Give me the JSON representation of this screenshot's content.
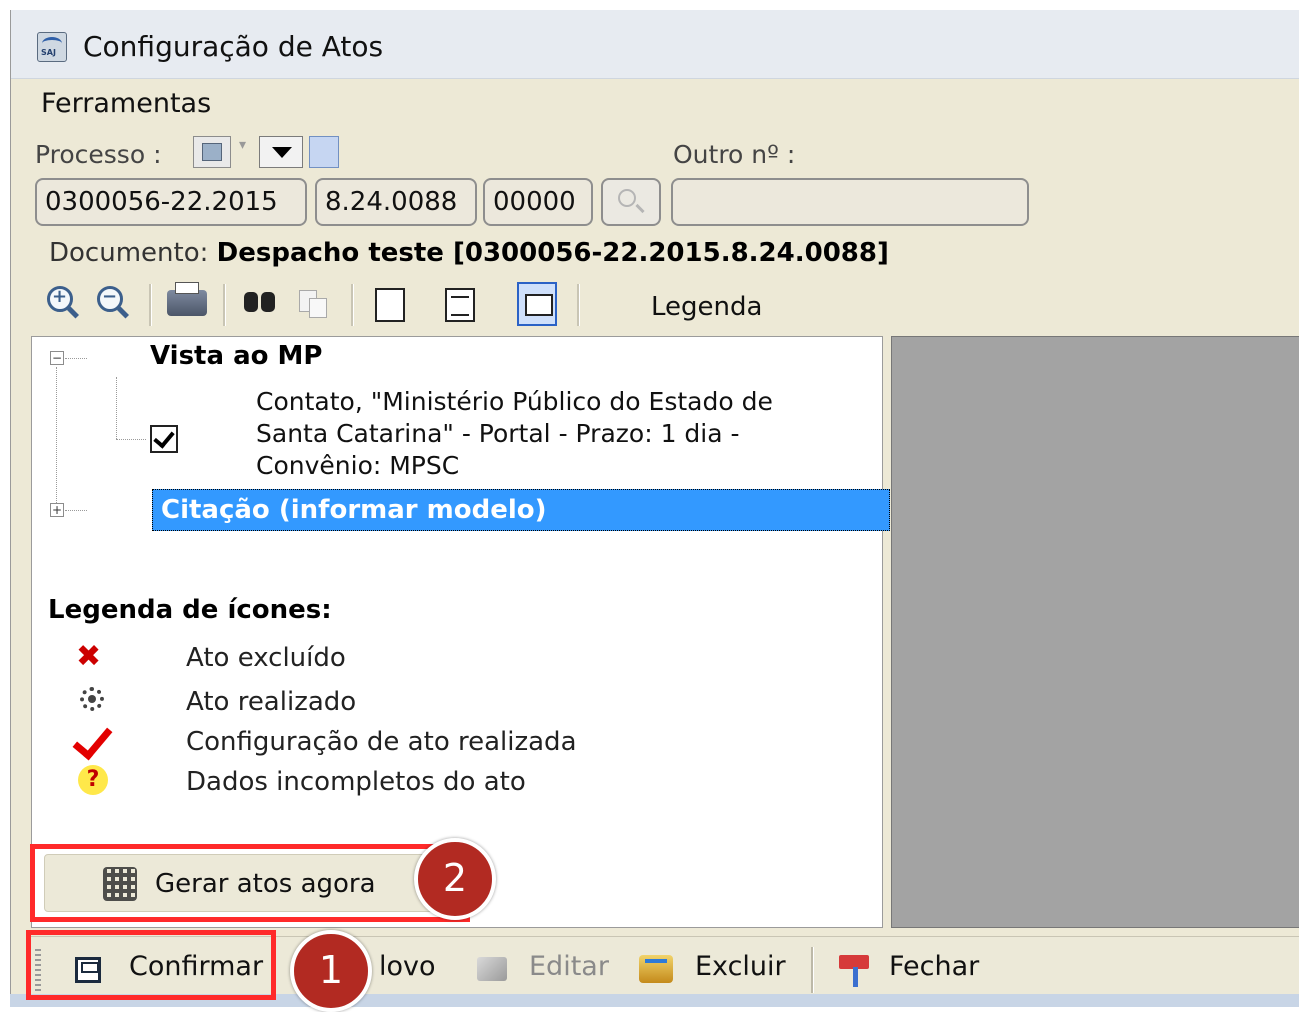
{
  "window": {
    "title": "Configuração de Atos"
  },
  "menu": {
    "items": [
      "Ferramentas"
    ]
  },
  "processo": {
    "label": "Processo :",
    "outro_label": "Outro nº :",
    "field1": "0300056-22.2015",
    "field2": "8.24.0088",
    "field3": "00000",
    "outro_value": ""
  },
  "documento": {
    "label": "Documento:",
    "value": "Despacho  teste [0300056-22.2015.8.24.0088]"
  },
  "toolbar": {
    "legenda_label": "Legenda"
  },
  "tree": {
    "node1": {
      "title": "Vista ao MP",
      "child_lines": [
        "Contato, \"Ministério Público do Estado de",
        "Santa Catarina\" - Portal - Prazo: 1 dia -",
        "Convênio: MPSC"
      ]
    },
    "node2": {
      "title": "Citação (informar modelo)"
    }
  },
  "legend": {
    "title": "Legenda de ícones:",
    "items": [
      {
        "icon": "x-icon",
        "text": "Ato excluído"
      },
      {
        "icon": "gear-icon",
        "text": "Ato realizado"
      },
      {
        "icon": "checkmark-icon",
        "text": "Configuração de ato realizada"
      },
      {
        "icon": "question-icon",
        "text": "Dados incompletos do ato"
      }
    ]
  },
  "gerar_button": {
    "label": "Gerar atos agora"
  },
  "bottom_bar": {
    "confirmar": "Confirmar",
    "novo": "lovo",
    "editar": "Editar",
    "excluir": "Excluir",
    "fechar": "Fechar"
  },
  "badges": {
    "one": "1",
    "two": "2"
  },
  "colors": {
    "highlight": "#ff2a2a",
    "badge": "#b22a22",
    "selection": "#3399ff"
  }
}
